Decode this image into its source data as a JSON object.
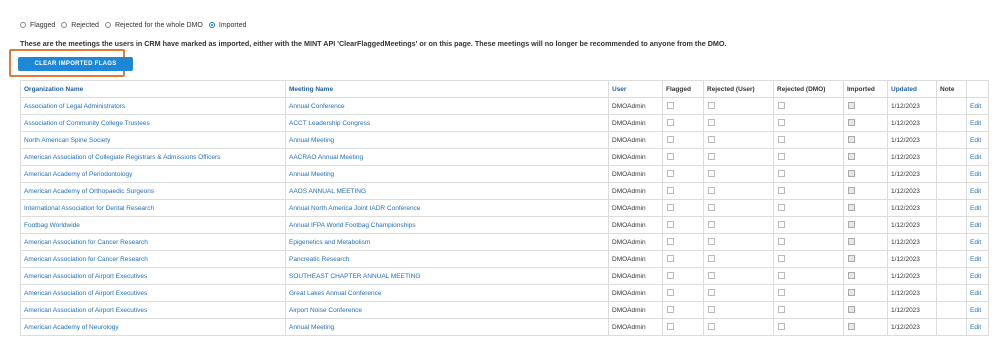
{
  "filters": [
    {
      "label": "Flagged",
      "checked": false
    },
    {
      "label": "Rejected",
      "checked": false
    },
    {
      "label": "Rejected for the whole DMO",
      "checked": false
    },
    {
      "label": "Imported",
      "checked": true
    }
  ],
  "description": "These are the meetings the users in CRM have marked as imported, either with the MINT API 'ClearFlaggedMeetings' or on this page. These meetings will no longer be recommended to anyone from the DMO.",
  "clear_button": "CLEAR IMPORTED FLAGS",
  "columns": [
    "Organization Name",
    "Meeting Name",
    "User",
    "Flagged",
    "Rejected (User)",
    "Rejected (DMO)",
    "Imported",
    "Updated",
    "Note",
    ""
  ],
  "rows": [
    {
      "org": "Association of Legal Administrators",
      "meeting": "Annual Conference",
      "user": "DMOAdmin",
      "flagged": false,
      "rej_user": false,
      "rej_dmo": false,
      "imported": true,
      "updated": "1/12/2023",
      "note": "",
      "action": "Edit"
    },
    {
      "org": "Association of Community College Trustees",
      "meeting": "ACCT Leadership Congress",
      "user": "DMOAdmin",
      "flagged": false,
      "rej_user": false,
      "rej_dmo": false,
      "imported": true,
      "updated": "1/12/2023",
      "note": "",
      "action": "Edit"
    },
    {
      "org": "North American Spine Society",
      "meeting": "Annual Meeting",
      "user": "DMOAdmin",
      "flagged": false,
      "rej_user": false,
      "rej_dmo": false,
      "imported": true,
      "updated": "1/12/2023",
      "note": "",
      "action": "Edit"
    },
    {
      "org": "American Association of Collegiate Registrars & Admissions Officers",
      "meeting": "AACRAO Annual Meeting",
      "user": "DMOAdmin",
      "flagged": false,
      "rej_user": false,
      "rej_dmo": false,
      "imported": true,
      "updated": "1/12/2023",
      "note": "",
      "action": "Edit"
    },
    {
      "org": "American Academy of Periodontology",
      "meeting": "Annual Meeting",
      "user": "DMOAdmin",
      "flagged": false,
      "rej_user": false,
      "rej_dmo": false,
      "imported": true,
      "updated": "1/12/2023",
      "note": "",
      "action": "Edit"
    },
    {
      "org": "American Academy of Orthopaedic Surgeons",
      "meeting": "AAOS ANNUAL MEETING",
      "user": "DMOAdmin",
      "flagged": false,
      "rej_user": false,
      "rej_dmo": false,
      "imported": true,
      "updated": "1/12/2023",
      "note": "",
      "action": "Edit"
    },
    {
      "org": "International Association for Dental Research",
      "meeting": "Annual North America Joint IADR Conference",
      "user": "DMOAdmin",
      "flagged": false,
      "rej_user": false,
      "rej_dmo": false,
      "imported": true,
      "updated": "1/12/2023",
      "note": "",
      "action": "Edit"
    },
    {
      "org": "Footbag Worldwide",
      "meeting": "Annual IFPA World Footbag Championships",
      "user": "DMOAdmin",
      "flagged": false,
      "rej_user": false,
      "rej_dmo": false,
      "imported": true,
      "updated": "1/12/2023",
      "note": "",
      "action": "Edit"
    },
    {
      "org": "American Association for Cancer Research",
      "meeting": "Epigenetics and Metabolism",
      "user": "DMOAdmin",
      "flagged": false,
      "rej_user": false,
      "rej_dmo": false,
      "imported": true,
      "updated": "1/12/2023",
      "note": "",
      "action": "Edit"
    },
    {
      "org": "American Association for Cancer Research",
      "meeting": "Pancreatic Research",
      "user": "DMOAdmin",
      "flagged": false,
      "rej_user": false,
      "rej_dmo": false,
      "imported": true,
      "updated": "1/12/2023",
      "note": "",
      "action": "Edit"
    },
    {
      "org": "American Association of Airport Executives",
      "meeting": "SOUTHEAST CHAPTER ANNUAL MEETING",
      "user": "DMOAdmin",
      "flagged": false,
      "rej_user": false,
      "rej_dmo": false,
      "imported": true,
      "updated": "1/12/2023",
      "note": "",
      "action": "Edit"
    },
    {
      "org": "American Association of Airport Executives",
      "meeting": "Great Lakes Annual Conference",
      "user": "DMOAdmin",
      "flagged": false,
      "rej_user": false,
      "rej_dmo": false,
      "imported": true,
      "updated": "1/12/2023",
      "note": "",
      "action": "Edit"
    },
    {
      "org": "American Association of Airport Executives",
      "meeting": "Airport Noise Conference",
      "user": "DMOAdmin",
      "flagged": false,
      "rej_user": false,
      "rej_dmo": false,
      "imported": true,
      "updated": "1/12/2023",
      "note": "",
      "action": "Edit"
    },
    {
      "org": "American Academy of Neurology",
      "meeting": "Annual Meeting",
      "user": "DMOAdmin",
      "flagged": false,
      "rej_user": false,
      "rej_dmo": false,
      "imported": true,
      "updated": "1/12/2023",
      "note": "",
      "action": "Edit"
    }
  ]
}
